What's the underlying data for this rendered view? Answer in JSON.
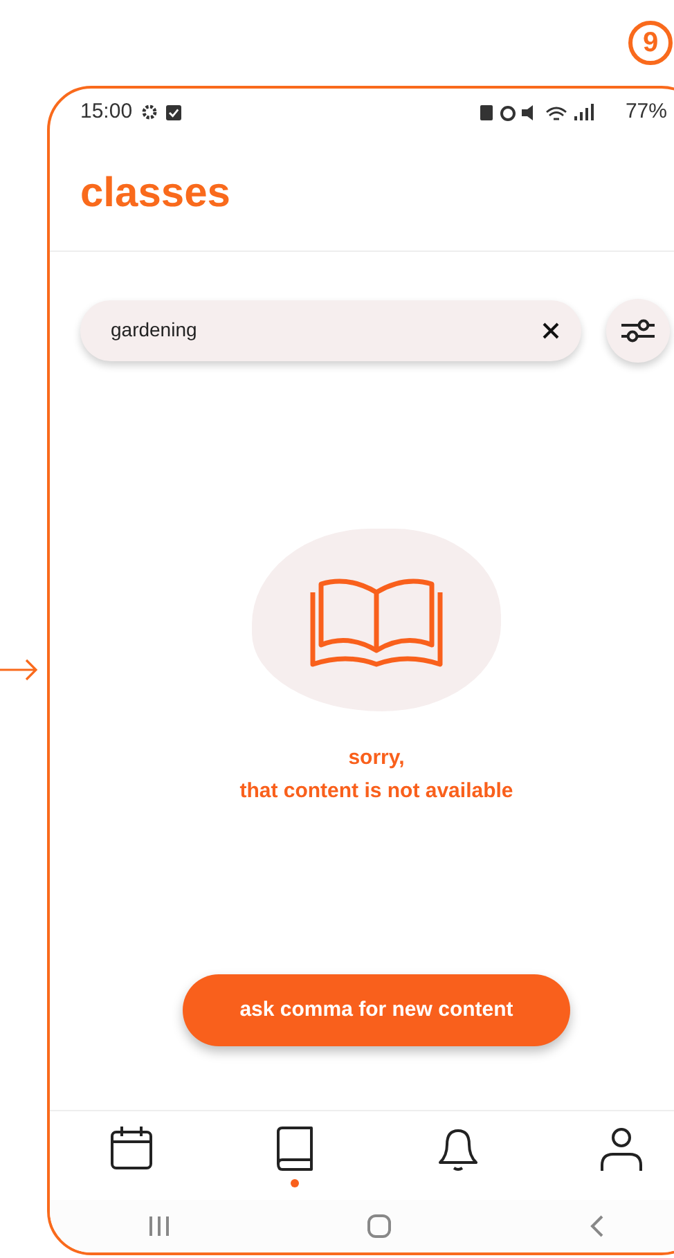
{
  "callout": "9",
  "status_bar": {
    "time": "15:00",
    "battery": "77%"
  },
  "header": {
    "title": "classes"
  },
  "search": {
    "value": "gardening"
  },
  "empty_state": {
    "lines": [
      "sorry,",
      "that content is not available"
    ]
  },
  "action_button": "ask comma for new content",
  "bottom_nav": [
    {
      "kind": "calendar",
      "selected": false
    },
    {
      "kind": "book",
      "selected": true
    },
    {
      "kind": "bell",
      "selected": false
    },
    {
      "kind": "person",
      "selected": false
    }
  ]
}
